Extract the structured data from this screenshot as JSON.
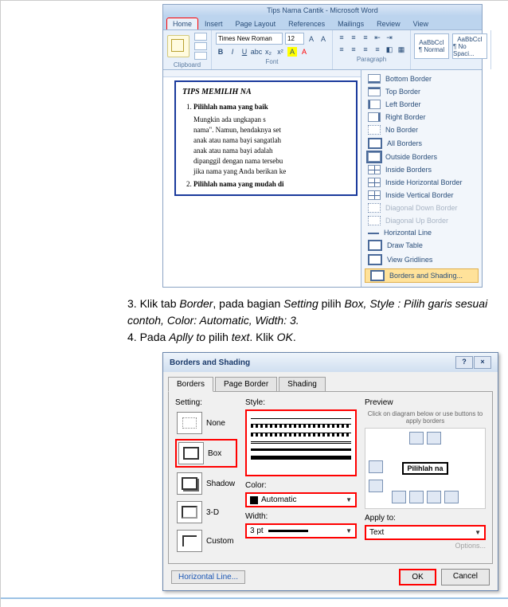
{
  "word": {
    "title": "Tips Nama Cantik - Microsoft Word",
    "tabs": [
      "Home",
      "Insert",
      "Page Layout",
      "References",
      "Mailings",
      "Review",
      "View"
    ],
    "clipboard": {
      "paste": "Paste",
      "label": "Clipboard"
    },
    "font": {
      "name": "Times New Roman",
      "size": "12",
      "label": "Font"
    },
    "paragraph": {
      "label": "Paragraph"
    },
    "styles": [
      {
        "sample": "AaBbCcI",
        "name": "¶ Normal"
      },
      {
        "sample": "AaBbCcI",
        "name": "¶ No Spaci..."
      }
    ],
    "border_menu": [
      {
        "key": "bb",
        "label": "Bottom Border",
        "u": true
      },
      {
        "key": "tb",
        "label": "Top Border",
        "u": true
      },
      {
        "key": "lb",
        "label": "Left Border",
        "u": true
      },
      {
        "key": "rb",
        "label": "Right Border",
        "u": true
      },
      {
        "key": "nb",
        "label": "No Border",
        "u": true
      },
      {
        "key": "ab",
        "label": "All Borders",
        "u": true
      },
      {
        "key": "ob",
        "label": "Outside Borders",
        "u": true
      },
      {
        "key": "ib",
        "label": "Inside Borders",
        "u": true
      },
      {
        "key": "ib",
        "label": "Inside Horizontal Border",
        "u": true
      },
      {
        "key": "ib",
        "label": "Inside Vertical Border",
        "u": true
      },
      {
        "key": "nb",
        "label": "Diagonal Down Border",
        "dis": true
      },
      {
        "key": "nb",
        "label": "Diagonal Up Border",
        "dis": true
      },
      {
        "key": "hl",
        "label": "Horizontal Line",
        "u": true
      },
      {
        "key": "ab",
        "label": "Draw Table",
        "u": true
      },
      {
        "key": "ab",
        "label": "View Gridlines",
        "u": true
      }
    ],
    "border_menu_hl": "Borders and Shading...",
    "doc": {
      "heading": "TIPS MEMILIH NA",
      "li1": "Pilihlah nama yang baik",
      "p": "Mungkin ada ungkapan s\nnama\". Namun, hendaknya set\nanak atau nama bayi sangatlah\nanak atau nama bayi adalah\ndipanggil dengan nama tersebu\njika nama yang Anda berikan ke",
      "li2": "Pilihlah nama yang mudah di"
    }
  },
  "instructions": {
    "step3_pre": "3. Klik tab ",
    "step3_a": "Border",
    "step3_mid1": ", pada bagian ",
    "step3_b": "Setting",
    "step3_mid2": " pilih ",
    "step3_c": "Box, Style : Pilih garis sesuai contoh, Color: Automatic, Width: 3.",
    "step4_pre": "4. Pada ",
    "step4_a": "Aplly to",
    "step4_mid": " pilih ",
    "step4_b": "text",
    "step4_post": ". Klik ",
    "step4_c": "OK",
    "step4_end": "."
  },
  "dialog": {
    "title": "Borders and Shading",
    "tabs": [
      "Borders",
      "Page Border",
      "Shading"
    ],
    "setting_label": "Setting:",
    "settings": [
      {
        "label": "None",
        "cls": "pv-none",
        "hl": false
      },
      {
        "label": "Box",
        "cls": "pv-box",
        "hl": true
      },
      {
        "label": "Shadow",
        "cls": "pv-shd",
        "hl": false
      },
      {
        "label": "3-D",
        "cls": "pv-3d",
        "hl": false
      },
      {
        "label": "Custom",
        "cls": "pv-cus",
        "hl": false
      }
    ],
    "style_label": "Style:",
    "color_label": "Color:",
    "color_value": "Automatic",
    "width_label": "Width:",
    "width_value": "3 pt",
    "preview_label": "Preview",
    "preview_hint": "Click on diagram below or use buttons to apply borders",
    "preview_sample": "Pilihlah na",
    "apply_label": "Apply to:",
    "apply_value": "Text",
    "options": "Options...",
    "hline": "Horizontal Line...",
    "ok": "OK",
    "cancel": "Cancel"
  }
}
